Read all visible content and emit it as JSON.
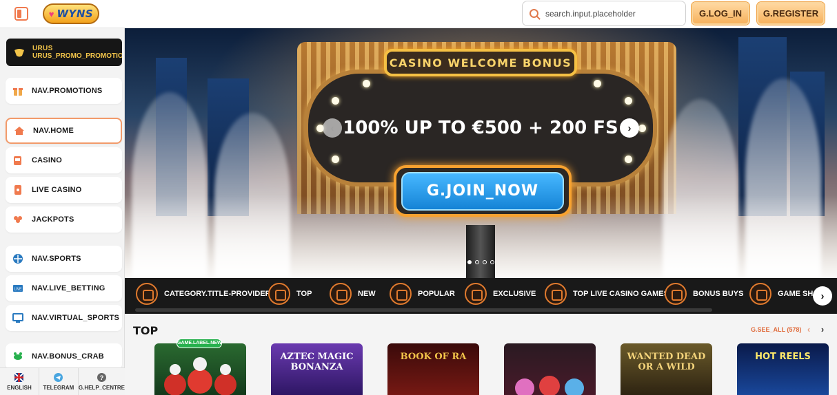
{
  "header": {
    "logo_text": "WYNS",
    "search_placeholder": "search.input.placeholder",
    "login_label": "G.LOG_IN",
    "register_label": "G.REGISTER"
  },
  "sidebar": {
    "promo": {
      "title": "URUS",
      "subtitle": "URUS_PROMO_PROMOTION_TI"
    },
    "items": [
      {
        "label": "NAV.PROMOTIONS",
        "icon": "gift-icon"
      },
      {
        "label": "NAV.HOME",
        "icon": "home-icon"
      },
      {
        "label": "CASINO",
        "icon": "slot-machine-icon"
      },
      {
        "label": "LIVE CASINO",
        "icon": "cards-icon"
      },
      {
        "label": "JACKPOTS",
        "icon": "clover-icon"
      },
      {
        "label": "NAV.SPORTS",
        "icon": "ball-icon"
      },
      {
        "label": "NAV.LIVE_BETTING",
        "icon": "live-tv-icon"
      },
      {
        "label": "NAV.VIRTUAL_SPORTS",
        "icon": "monitor-icon"
      },
      {
        "label": "NAV.BONUS_CRAB",
        "icon": "crab-icon"
      }
    ],
    "footer": [
      {
        "label": "ENGLISH",
        "icon": "uk-flag-icon"
      },
      {
        "label": "TELEGRAM",
        "icon": "telegram-icon"
      },
      {
        "label": "G.HELP_CENTRE",
        "icon": "help-icon"
      }
    ]
  },
  "hero": {
    "tab_text": "CASINO WELCOME BONUS",
    "headline": "100% UP TO €500 + 200 FS",
    "cta_label": "G.JOIN_NOW",
    "slides": 4,
    "active_slide": 1
  },
  "categories": [
    "CATEGORY.TITLE-PROVIDERS",
    "TOP",
    "NEW",
    "POPULAR",
    "EXCLUSIVE",
    "TOP LIVE CASINO GAMES",
    "BONUS BUYS",
    "GAME SHOWS"
  ],
  "games": {
    "title": "TOP",
    "see_all": "G.SEE_ALL (578)",
    "new_badge": "GAME.LABEL.NEW",
    "tiles": [
      {
        "label": "",
        "color": "#1f5a2a"
      },
      {
        "label": "AZTEC MAGIC BONANZA",
        "color": "#4a2a8a"
      },
      {
        "label": "BOOK OF RA",
        "color": "#5a0f0f"
      },
      {
        "label": "",
        "color": "#2a1a22"
      },
      {
        "label": "WANTED DEAD OR A WILD",
        "color": "#5a4a1a"
      },
      {
        "label": "HOT REELS",
        "color": "#0a2a66"
      }
    ]
  },
  "colors": {
    "accent": "#f07a4e",
    "button_gold": "#f6b25e",
    "cta_blue": "#1583d6",
    "dark_bar": "#191919"
  }
}
